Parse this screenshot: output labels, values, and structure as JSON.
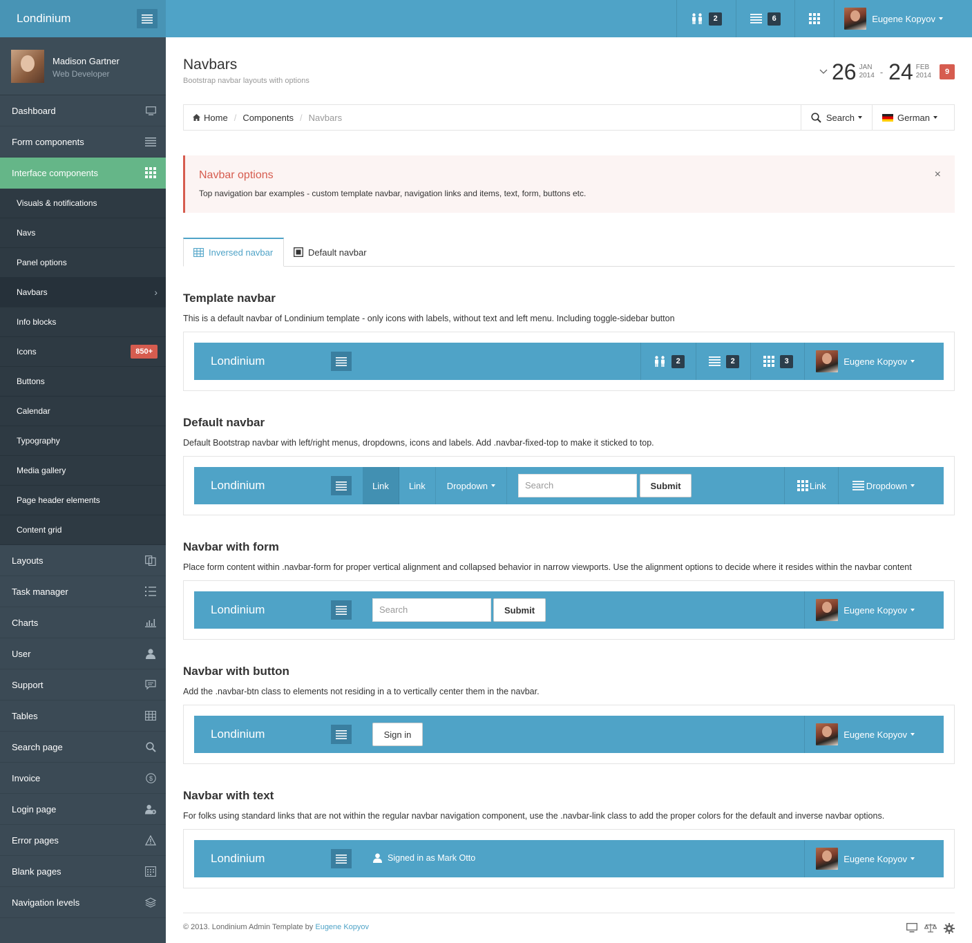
{
  "topbar": {
    "brand": "Londinium",
    "items": [
      {
        "icon": "users-icon",
        "count": "2"
      },
      {
        "icon": "list-icon",
        "count": "6"
      },
      {
        "icon": "grid-icon",
        "count": ""
      }
    ],
    "user": "Eugene Kopyov"
  },
  "sidebar": {
    "profile": {
      "name": "Madison Gartner",
      "role": "Web Developer"
    },
    "items": [
      {
        "label": "Dashboard"
      },
      {
        "label": "Form components"
      },
      {
        "label": "Interface components"
      },
      {
        "label": "Layouts"
      },
      {
        "label": "Task manager"
      },
      {
        "label": "Charts"
      },
      {
        "label": "User"
      },
      {
        "label": "Support"
      },
      {
        "label": "Tables"
      },
      {
        "label": "Search page"
      },
      {
        "label": "Invoice"
      },
      {
        "label": "Login page"
      },
      {
        "label": "Error pages"
      },
      {
        "label": "Blank pages"
      },
      {
        "label": "Navigation levels"
      }
    ],
    "subitems": [
      {
        "label": "Visuals & notifications"
      },
      {
        "label": "Navs"
      },
      {
        "label": "Panel options"
      },
      {
        "label": "Navbars"
      },
      {
        "label": "Info blocks"
      },
      {
        "label": "Icons",
        "badge": "850+"
      },
      {
        "label": "Buttons"
      },
      {
        "label": "Calendar"
      },
      {
        "label": "Typography"
      },
      {
        "label": "Media gallery"
      },
      {
        "label": "Page header elements"
      },
      {
        "label": "Content grid"
      }
    ]
  },
  "page": {
    "title": "Navbars",
    "subtitle": "Bootstrap navbar layouts with options",
    "date_from": {
      "day": "26",
      "month": "JAN",
      "year": "2014"
    },
    "date_to": {
      "day": "24",
      "month": "FEB",
      "year": "2014"
    },
    "date_badge": "9"
  },
  "breadcrumb": {
    "home": "Home",
    "components": "Components",
    "current": "Navbars",
    "search": "Search",
    "language": "German"
  },
  "alert": {
    "heading": "Navbar options",
    "text": "Top navigation bar examples - custom template navbar, navigation links and items, text, form, buttons etc."
  },
  "tabs": {
    "inversed": "Inversed navbar",
    "default": "Default navbar"
  },
  "sections": {
    "template": {
      "heading": "Template navbar",
      "text": "This is a default navbar of Londinium template - only icons with labels, without text and left menu. Including toggle-sidebar button",
      "counts": [
        "2",
        "2",
        "3"
      ]
    },
    "default": {
      "heading": "Default navbar",
      "text": "Default Bootstrap navbar with left/right menus, dropdowns, icons and labels. Add .navbar-fixed-top to make it sticked to top.",
      "link1": "Link",
      "link2": "Link",
      "dropdown": "Dropdown",
      "search_placeholder": "Search",
      "submit": "Submit",
      "right_link": "Link",
      "right_dropdown": "Dropdown"
    },
    "form": {
      "heading": "Navbar with form",
      "text": "Place form content within .navbar-form for proper vertical alignment and collapsed behavior in narrow viewports. Use the alignment options to decide where it resides within the navbar content",
      "search_placeholder": "Search",
      "submit": "Submit"
    },
    "button": {
      "heading": "Navbar with button",
      "text": "Add the .navbar-btn class to elements not residing in a to vertically center them in the navbar.",
      "signin": "Sign in"
    },
    "text": {
      "heading": "Navbar with text",
      "text": "For folks using standard links that are not within the regular navbar navigation component, use the .navbar-link class to add the proper colors for the default and inverse navbar options.",
      "signed": "Signed in as Mark Otto"
    }
  },
  "demo_brand": "Londinium",
  "demo_user": "Eugene Kopyov",
  "footer": {
    "copyright": "© 2013. Londinium Admin Template by ",
    "author": "Eugene Kopyov"
  },
  "colors": {
    "primary": "#4fa3c7",
    "sidebar": "#3b4a55",
    "active": "#65b688",
    "danger": "#d65c4f"
  }
}
